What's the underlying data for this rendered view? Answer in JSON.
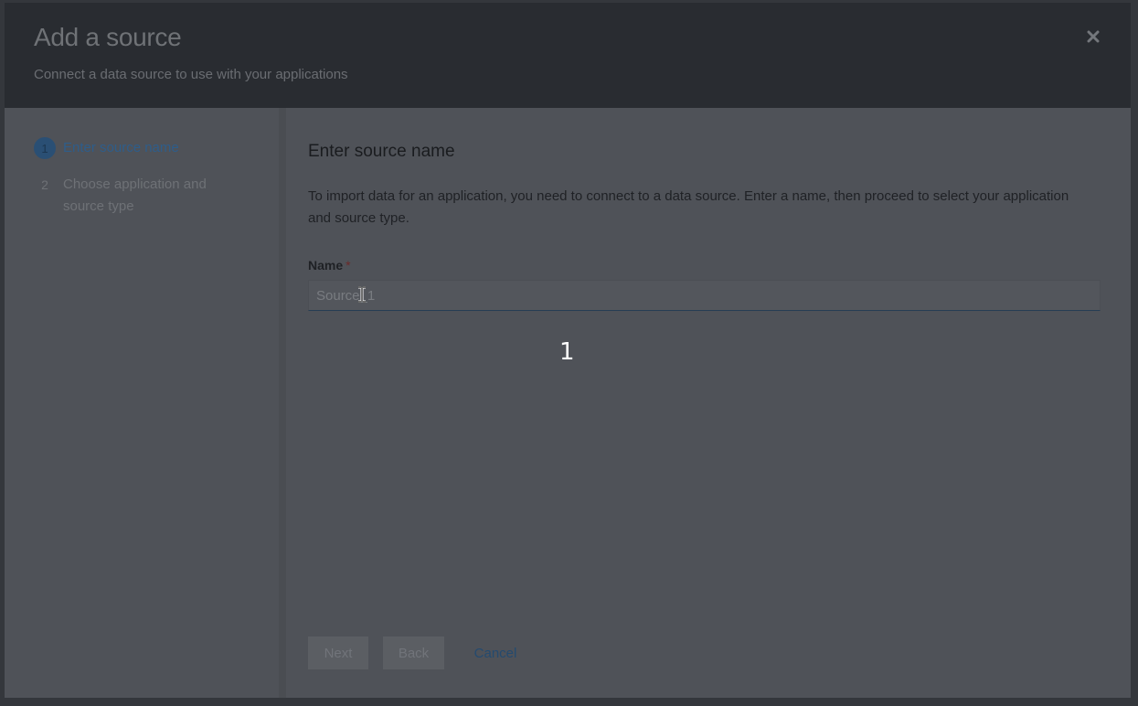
{
  "modal": {
    "title": "Add a source",
    "subtitle": "Connect a data source to use with your applications",
    "close_icon": "close-icon"
  },
  "wizard_nav": {
    "steps": [
      {
        "number": "1",
        "label": "Enter source name",
        "current": true
      },
      {
        "number": "2",
        "label": "Choose application and source type",
        "current": false
      }
    ]
  },
  "step_content": {
    "title": "Enter source name",
    "description": "To import data for an application, you need to connect to a data source. Enter a name, then proceed to select your application and source type.",
    "name_field": {
      "label": "Name",
      "required_mark": "*",
      "value": "",
      "placeholder": "Source_1"
    }
  },
  "overlay_marker": "1",
  "footer": {
    "next_label": "Next",
    "back_label": "Back",
    "cancel_label": "Cancel"
  },
  "colors": {
    "header_bg": "#292c31",
    "modal_bg": "#4f5258",
    "accent": "#2e5d8a"
  }
}
